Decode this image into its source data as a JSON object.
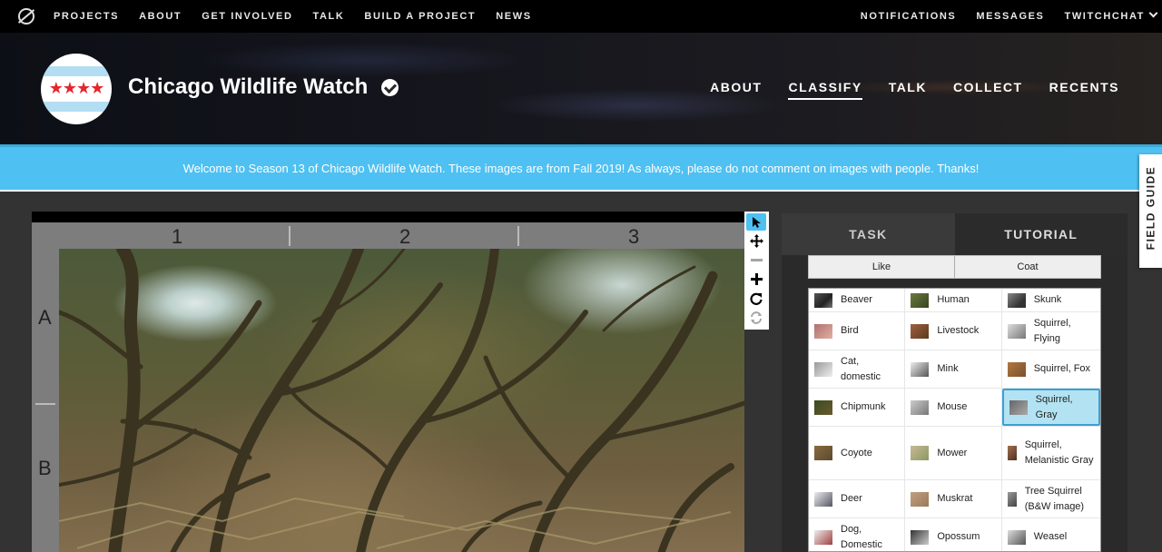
{
  "topnav": {
    "left": [
      "PROJECTS",
      "ABOUT",
      "GET INVOLVED",
      "TALK",
      "BUILD A PROJECT",
      "NEWS"
    ],
    "right": [
      "NOTIFICATIONS",
      "MESSAGES",
      "TWITCHCHAT"
    ]
  },
  "project": {
    "title": "Chicago Wildlife Watch",
    "nav": [
      "ABOUT",
      "CLASSIFY",
      "TALK",
      "COLLECT",
      "RECENTS"
    ],
    "active_nav": "CLASSIFY"
  },
  "announcement": "Welcome to Season 13 of Chicago Wildlife Watch. These images are from Fall 2019! As always, please do not comment on images with people. Thanks!",
  "field_guide": "FIELD GUIDE",
  "viewer": {
    "columns": [
      "1",
      "2",
      "3"
    ],
    "rows": [
      "A",
      "B"
    ]
  },
  "panel": {
    "tabs": [
      "TASK",
      "TUTORIAL"
    ],
    "filters": [
      "Like",
      "Coat"
    ],
    "choices": [
      [
        "Beaver",
        "Human",
        "Skunk"
      ],
      [
        "Bird",
        "Livestock",
        "Squirrel, Flying"
      ],
      [
        "Cat, domestic",
        "Mink",
        "Squirrel, Fox"
      ],
      [
        "Chipmunk",
        "Mouse",
        "Squirrel, Gray"
      ],
      [
        "Coyote",
        "Mower",
        "Squirrel, Melanistic Gray"
      ],
      [
        "Deer",
        "Muskrat",
        "Tree Squirrel (B&W image)"
      ],
      [
        "Dog, Domestic",
        "Opossum",
        "Weasel"
      ]
    ],
    "selected": "Squirrel, Gray"
  },
  "colors": {
    "accent": "#4ec0f2",
    "selected_choice": "#b3e3f3"
  }
}
